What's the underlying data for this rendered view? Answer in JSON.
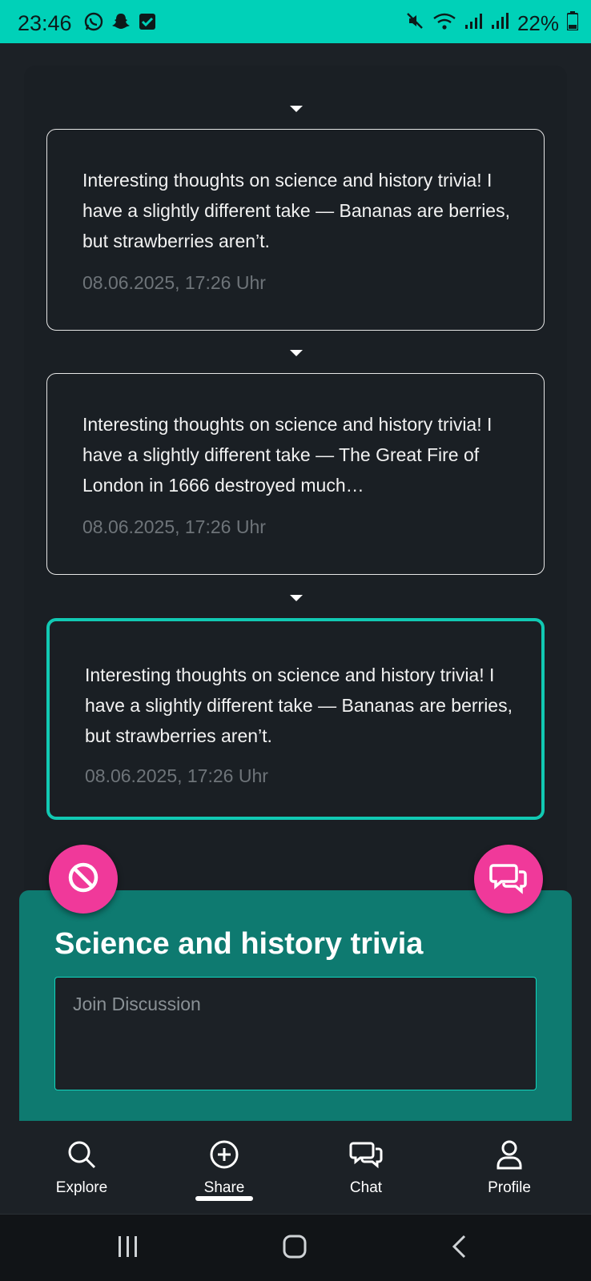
{
  "status_bar": {
    "time": "23:46",
    "left_icons": [
      "whatsapp-icon",
      "snapchat-icon",
      "checkbox-notification-icon"
    ],
    "right_icons": [
      "mute-icon",
      "wifi-icon",
      "signal-icon",
      "signal-roaming-icon",
      "battery-icon"
    ],
    "battery": "22%"
  },
  "feed": {
    "cards": [
      {
        "text": "Interesting thoughts on science and history trivia! I have a slightly different take — Bananas are berries, but strawberries aren’t.",
        "timestamp": "08.06.2025, 17:26 Uhr",
        "selected": false
      },
      {
        "text": "Interesting thoughts on science and history trivia! I have a slightly different take — The Great Fire of London in 1666 destroyed much…",
        "timestamp": "08.06.2025, 17:26 Uhr",
        "selected": false
      },
      {
        "text": "Interesting thoughts on science and history trivia! I have a slightly different take — Bananas are berries, but strawberries aren’t.",
        "timestamp": "08.06.2025, 17:26 Uhr",
        "selected": true
      }
    ]
  },
  "discussion": {
    "title": "Science and history trivia",
    "input_placeholder": "Join Discussion",
    "input_value": ""
  },
  "actions": {
    "left_icon": "block-icon",
    "right_icon": "chat-bubbles-icon"
  },
  "bottom_nav": {
    "items": [
      {
        "label": "Explore",
        "icon": "search-icon"
      },
      {
        "label": "Share",
        "icon": "plus-circle-icon",
        "active": true
      },
      {
        "label": "Chat",
        "icon": "chat-bubbles-icon"
      },
      {
        "label": "Profile",
        "icon": "person-icon"
      }
    ]
  },
  "system_nav": {
    "icons": [
      "recent-apps-icon",
      "home-icon",
      "back-icon"
    ]
  },
  "colors": {
    "accent": "#00d1b8",
    "panel": "#0e7a70",
    "fab": "#f0399a",
    "background": "#1c2126"
  }
}
